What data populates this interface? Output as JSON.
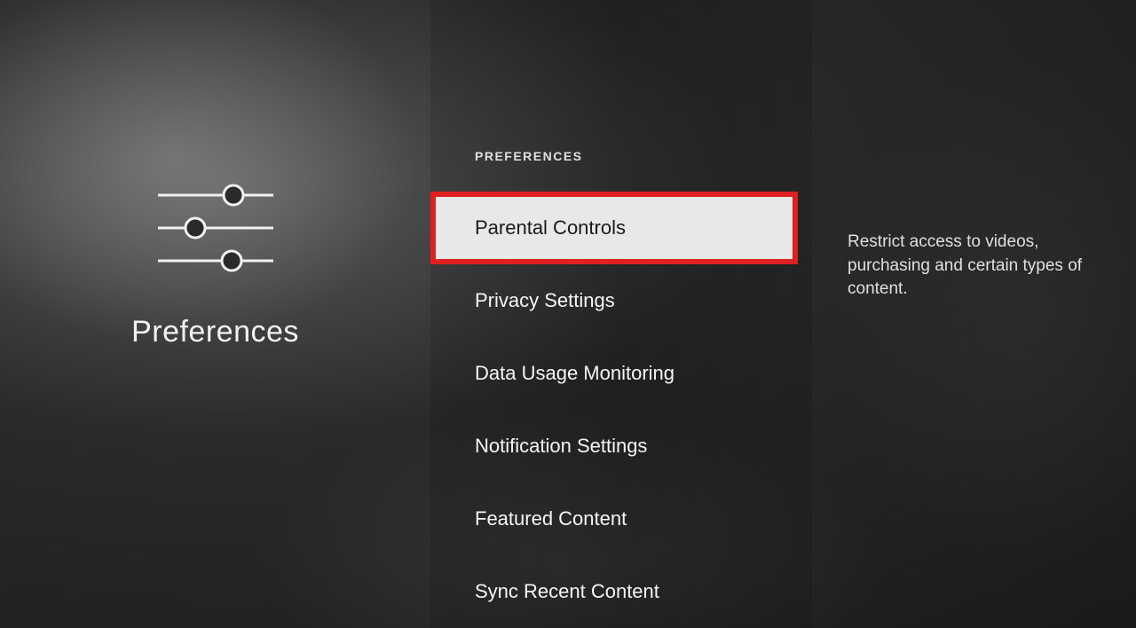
{
  "left": {
    "title": "Preferences"
  },
  "middle": {
    "header": "PREFERENCES",
    "items": [
      {
        "label": "Parental Controls",
        "selected": true
      },
      {
        "label": "Privacy Settings",
        "selected": false
      },
      {
        "label": "Data Usage Monitoring",
        "selected": false
      },
      {
        "label": "Notification Settings",
        "selected": false
      },
      {
        "label": "Featured Content",
        "selected": false
      },
      {
        "label": "Sync Recent Content",
        "selected": false
      }
    ]
  },
  "right": {
    "description": "Restrict access to videos, purchasing and certain types of content."
  }
}
